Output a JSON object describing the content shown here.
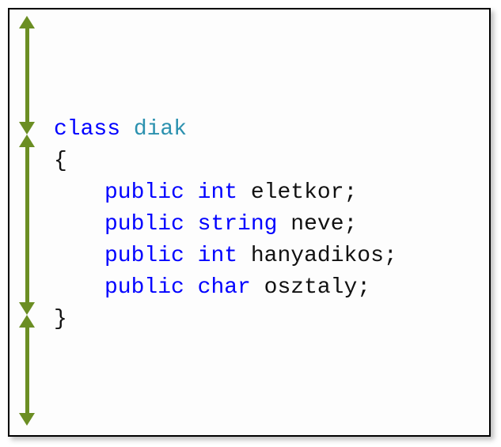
{
  "code": {
    "keyword_class": "class",
    "class_name": "diak",
    "brace_open": "{",
    "brace_close": "}",
    "keyword_public": "public",
    "fields": [
      {
        "type": "int",
        "name": "eletkor"
      },
      {
        "type": "string",
        "name": "neve"
      },
      {
        "type": "int",
        "name": "hanyadikos"
      },
      {
        "type": "char",
        "name": "osztaly"
      }
    ],
    "semicolon": ";"
  },
  "colors": {
    "keyword": "#0000ff",
    "type": "#2b91af",
    "arrow": "#6b8e23"
  }
}
